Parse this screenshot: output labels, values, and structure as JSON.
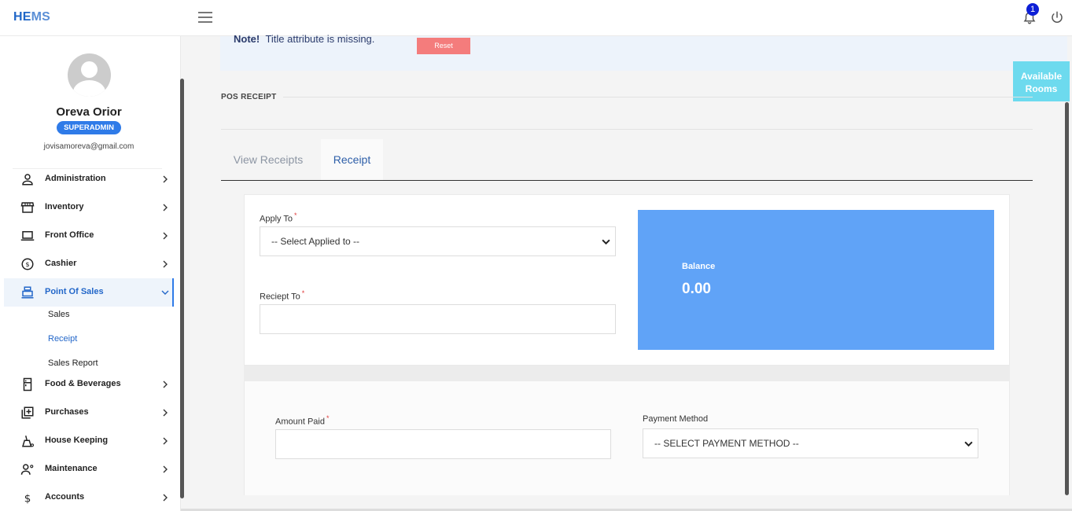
{
  "app": {
    "logo_a": "HE",
    "logo_b": "MS",
    "notification_count": "1"
  },
  "user": {
    "name": "Oreva Orior",
    "role": "SUPERADMIN",
    "email": "jovisamoreva@gmail.com"
  },
  "sidebar": {
    "items": [
      {
        "label": "Administration"
      },
      {
        "label": "Inventory"
      },
      {
        "label": "Front Office"
      },
      {
        "label": "Cashier"
      },
      {
        "label": "Point Of Sales"
      },
      {
        "label": "Food & Beverages"
      },
      {
        "label": "Purchases"
      },
      {
        "label": "House Keeping"
      },
      {
        "label": "Maintenance"
      },
      {
        "label": "Accounts"
      }
    ],
    "sub_items": [
      {
        "label": "Sales"
      },
      {
        "label": "Receipt"
      },
      {
        "label": "Sales Report"
      }
    ]
  },
  "note": {
    "prefix": "Note!",
    "text": "Title attribute is missing.",
    "reset_label": "Reset"
  },
  "available_rooms": "Available Rooms",
  "page": {
    "section_title": "POS RECEIPT",
    "tabs": [
      {
        "label": "View Receipts"
      },
      {
        "label": "Receipt"
      }
    ]
  },
  "form": {
    "apply_to_label": "Apply To",
    "apply_to_value": "-- Select Applied to --",
    "receipt_to_label": "Reciept To",
    "amount_paid_label": "Amount Paid",
    "payment_method_label": "Payment Method",
    "payment_method_value": "-- SELECT PAYMENT METHOD --",
    "required_mark": "*"
  },
  "balance": {
    "label": "Balance",
    "value": "0.00"
  },
  "colors": {
    "primary": "#2f7be8",
    "balance_bg": "#60a3f7",
    "reset": "#f47c7c",
    "available": "#6ddaee"
  }
}
